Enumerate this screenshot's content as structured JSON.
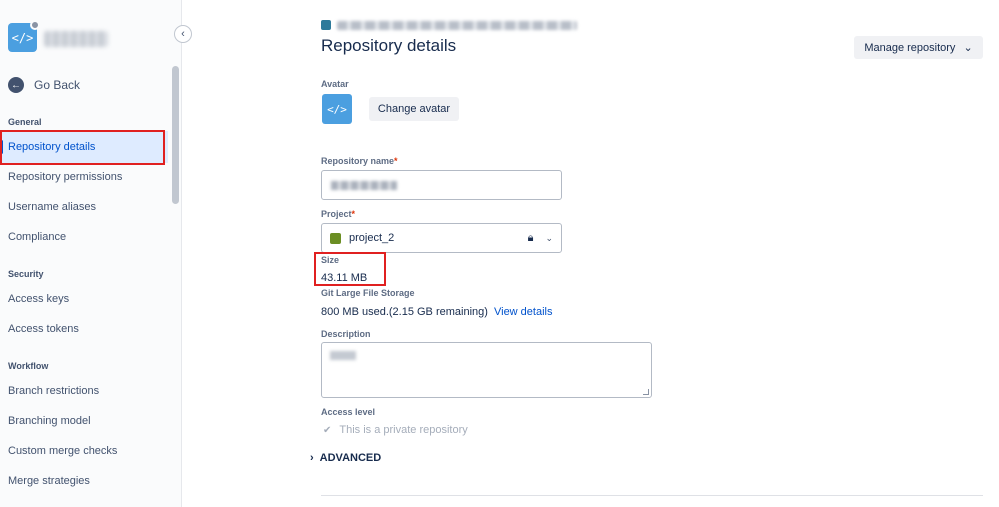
{
  "sidebar": {
    "logo_glyph": "</>",
    "go_back_label": "Go Back",
    "collapse_glyph": "‹",
    "sections": [
      {
        "label": "General",
        "items": [
          "Repository details",
          "Repository permissions",
          "Username aliases",
          "Compliance"
        ]
      },
      {
        "label": "Security",
        "items": [
          "Access keys",
          "Access tokens"
        ]
      },
      {
        "label": "Workflow",
        "items": [
          "Branch restrictions",
          "Branching model",
          "Custom merge checks",
          "Merge strategies"
        ]
      }
    ],
    "active_item": "Repository details"
  },
  "header": {
    "title": "Repository details",
    "manage_label": "Manage repository"
  },
  "form": {
    "avatar_label": "Avatar",
    "avatar_glyph": "</>",
    "change_avatar_label": "Change avatar",
    "name_label": "Repository name",
    "required_mark": "*",
    "project_label": "Project",
    "project_value": "project_2",
    "size_label": "Size",
    "size_value": "43.11 MB",
    "lfs_label": "Git Large File Storage",
    "lfs_usage": "800 MB used.(2.15 GB remaining)",
    "lfs_link": "View details",
    "description_label": "Description",
    "access_label": "Access level",
    "private_label": "This is a private repository",
    "advanced_label": "ADVANCED"
  },
  "colors": {
    "accent": "#0052cc",
    "highlight": "#e02020",
    "logo": "#4b9fe0",
    "project_icon": "#6b8e23"
  }
}
